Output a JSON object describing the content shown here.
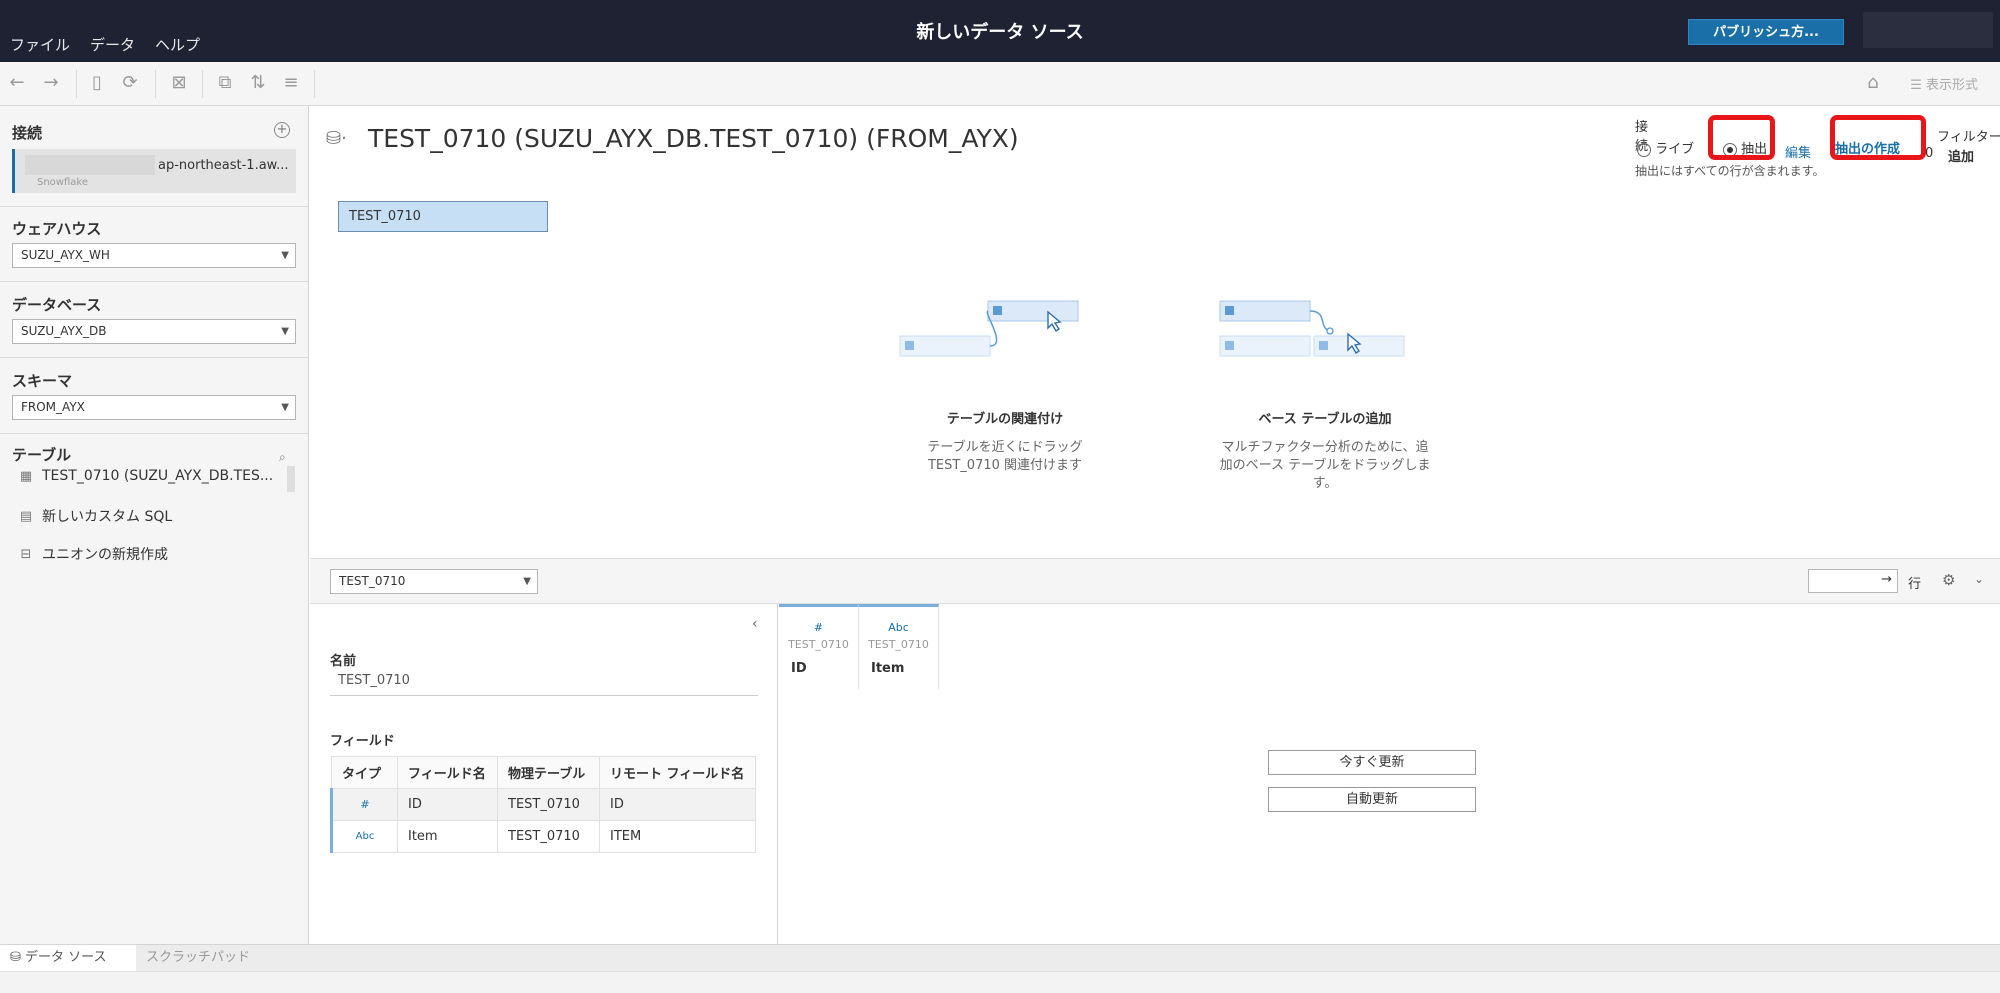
{
  "titlebar": {
    "menu": [
      "ファイル",
      "データ",
      "ヘルプ"
    ],
    "title": "新しいデータ ソース",
    "publish_label": "パブリッシュ方..."
  },
  "toolbar": {
    "display_format_label": "表示形式"
  },
  "left": {
    "connections_heading": "接続",
    "connection_host": "ap-northeast-1.aw...",
    "connection_type": "Snowflake",
    "warehouse_heading": "ウェアハウス",
    "warehouse_value": "SUZU_AYX_WH",
    "database_heading": "データベース",
    "database_value": "SUZU_AYX_DB",
    "schema_heading": "スキーマ",
    "schema_value": "FROM_AYX",
    "tables_heading": "テーブル",
    "items": [
      "TEST_0710 (SUZU_AYX_DB.TES...",
      "新しいカスタム SQL",
      "ユニオンの新規作成"
    ]
  },
  "canvas": {
    "title": "TEST_0710 (SUZU_AYX_DB.TEST_0710) (FROM_AYX)",
    "table_pill": "TEST_0710",
    "connection_label": "接続",
    "live_label": "ライブ",
    "extract_label": "抽出",
    "edit_label": "編集",
    "create_extract_label": "抽出の作成",
    "extract_note": "抽出にはすべての行が含まれます。",
    "filter_label": "フィルター",
    "filter_count": "0",
    "add_label": "追加",
    "relate_caption": "テーブルの関連付け",
    "relate_desc": [
      "テーブルを近くにドラッグ",
      "TEST_0710 関連付けます"
    ],
    "base_caption": "ベース テーブルの追加",
    "base_desc": [
      "マルチファクター分析のために、追",
      "加のベース テーブルをドラッグしま",
      "す。"
    ]
  },
  "lower": {
    "table_select": "TEST_0710",
    "rows_label": "行",
    "name_heading": "名前",
    "name_value": "TEST_0710",
    "fields_heading": "フィールド",
    "columns": [
      "タイプ",
      "フィールド名",
      "物理テーブル",
      "リモート フィールド名"
    ],
    "rows": [
      {
        "type": "#",
        "field": "ID",
        "table": "TEST_0710",
        "remote": "ID"
      },
      {
        "type": "Abc",
        "field": "Item",
        "table": "TEST_0710",
        "remote": "ITEM"
      }
    ],
    "grid_cols": [
      {
        "type": "#",
        "table": "TEST_0710",
        "name": "ID"
      },
      {
        "type": "Abc",
        "table": "TEST_0710",
        "name": "Item"
      }
    ],
    "update_now": "今すぐ更新",
    "auto_update": "自動更新"
  },
  "tabs": {
    "datasource": "データ ソース",
    "scratchpad": "スクラッチパッド"
  }
}
